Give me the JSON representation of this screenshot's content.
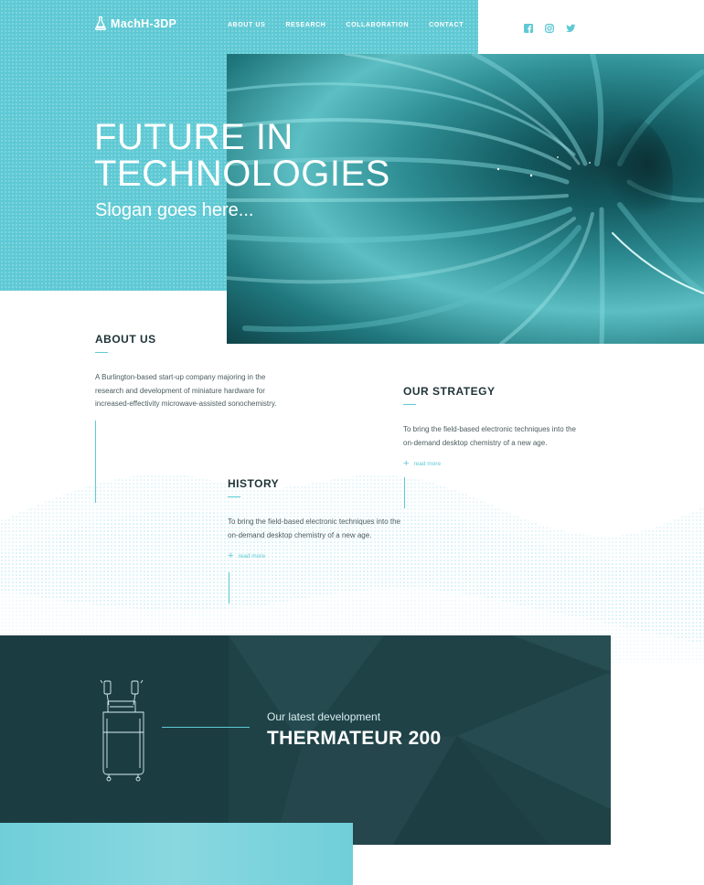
{
  "brand": {
    "name": "MachH-3DP",
    "icon": "flask-icon"
  },
  "nav": {
    "items": [
      "ABOUT US",
      "RESEARCH",
      "COLLABORATION",
      "CONTACT"
    ]
  },
  "social": {
    "icons": [
      "facebook-icon",
      "instagram-icon",
      "twitter-icon"
    ]
  },
  "hero": {
    "title_line1": "FUTURE IN",
    "title_line2": "TECHNOLOGIES",
    "slogan": "Slogan goes here..."
  },
  "about": {
    "title": "ABOUT US",
    "text_lines": [
      "A Burlington-based start-up company majoring in the",
      "research and development of miniature hardware  for",
      "increased-effectivity microwave-assisted sonochemistry."
    ]
  },
  "strategy": {
    "title": "OUR STRATEGY",
    "text_lines": [
      "To bring the field-based electronic techniques into the",
      "on-demand desktop chemistry of a new age."
    ],
    "read_more": "read more"
  },
  "history": {
    "title": "HISTORY",
    "text_lines": [
      "To bring the field-based electronic techniques into the",
      "on-demand desktop chemistry of a new age."
    ],
    "read_more": "read more"
  },
  "product": {
    "subtitle": "Our latest development",
    "title": "THERMATEUR 200"
  },
  "colors": {
    "accent": "#5ec9d4",
    "dark": "#1b3d42",
    "text": "#1f3338"
  }
}
